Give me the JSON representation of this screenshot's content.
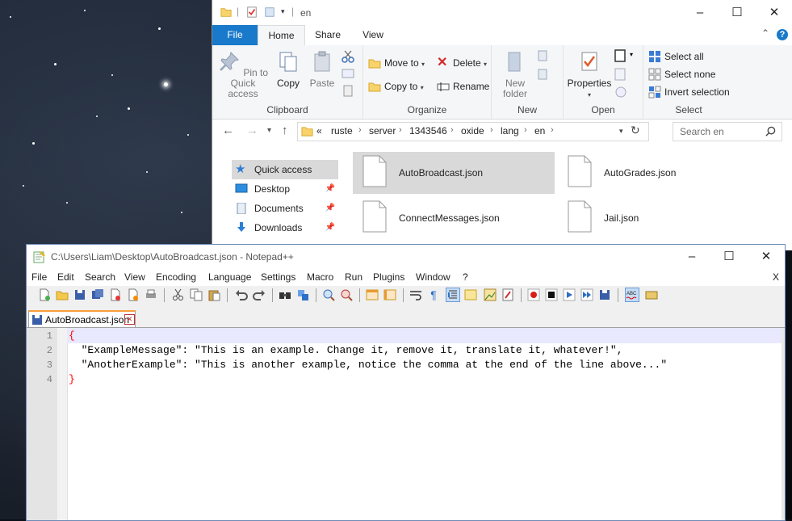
{
  "explorer": {
    "title": "en",
    "tabs": {
      "file": "File",
      "home": "Home",
      "share": "Share",
      "view": "View"
    },
    "clipboard": {
      "label": "Clipboard",
      "pin": "Pin to Quick access",
      "copy": "Copy",
      "paste": "Paste"
    },
    "organize": {
      "label": "Organize",
      "move_to": "Move to",
      "copy_to": "Copy to",
      "delete": "Delete",
      "rename": "Rename"
    },
    "new": {
      "label": "New",
      "new_folder": "New folder"
    },
    "open": {
      "label": "Open",
      "properties": "Properties"
    },
    "select": {
      "label": "Select",
      "select_all": "Select all",
      "select_none": "Select none",
      "invert": "Invert selection"
    },
    "address": {
      "prefix": "«",
      "crumbs": [
        "ruste",
        "server",
        "1343546",
        "oxide",
        "lang",
        "en"
      ]
    },
    "search_placeholder": "Search en",
    "nav": [
      "Quick access",
      "Desktop",
      "Documents",
      "Downloads"
    ],
    "files": [
      "AutoBroadcast.json",
      "AutoGrades.json",
      "ConnectMessages.json",
      "Jail.json"
    ]
  },
  "notepad": {
    "title": "C:\\Users\\Liam\\Desktop\\AutoBroadcast.json - Notepad++",
    "menu": [
      "File",
      "Edit",
      "Search",
      "View",
      "Encoding",
      "Language",
      "Settings",
      "Macro",
      "Run",
      "Plugins",
      "Window",
      "?"
    ],
    "menu_close": "X",
    "tab_label": "AutoBroadcast.json",
    "line_numbers": [
      "1",
      "2",
      "3",
      "4"
    ],
    "lines": [
      "{",
      "  \"ExampleMessage\": \"This is an example. Change it, remove it, translate it, whatever!\",",
      "  \"AnotherExample\": \"This is another example, notice the comma at the end of the line above...\"",
      "}"
    ]
  },
  "colors": {
    "ribbon_blue": "#1979ca",
    "selection_gray": "#d9d9d9",
    "brace_red": "#ff0000",
    "tab_accent": "#fa9d3a"
  }
}
